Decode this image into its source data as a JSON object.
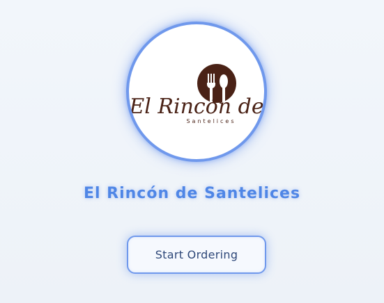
{
  "colors": {
    "accent": "#6f98ec",
    "title": "#4f86e6",
    "logo_brown": "#4a2216",
    "button_text": "#2d4778"
  },
  "logo": {
    "script_text": "El Rincón de",
    "sub_text": "Santelices",
    "icon": "fork-and-spoon-icon"
  },
  "title": "El Rincón de Santelices",
  "start_button": {
    "label": "Start Ordering"
  }
}
